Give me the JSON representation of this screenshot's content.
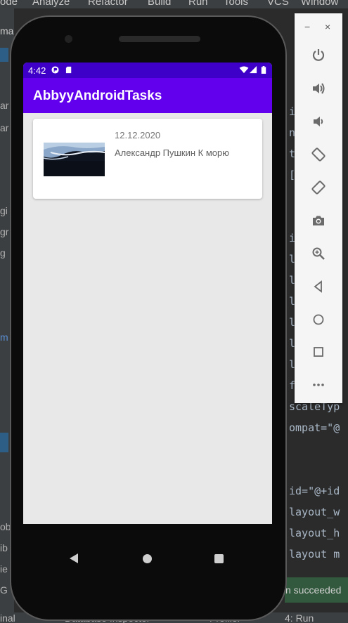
{
  "ide": {
    "menu": [
      "ode",
      "Analyze",
      "Refactor",
      "Build",
      "Run",
      "Tools",
      "VCS",
      "Window"
    ],
    "left_fragments": [
      "mai",
      "ar",
      "ar",
      "gi",
      "gr",
      "g",
      "m",
      "ob",
      "ib",
      "ie",
      "G"
    ],
    "code_lines": [
      "i",
      "n",
      "t",
      "[",
      "i",
      "l",
      "l",
      "l",
      "l",
      "l",
      "l",
      "f",
      "scaleTyp",
      "ompat=\"@",
      "id=\"@+id",
      "layout_w",
      "layout_h",
      "layout m"
    ],
    "bottom_items": [
      "inal",
      "Database Inspector",
      "Profiler",
      "4: Run"
    ],
    "status_text": "n succeeded"
  },
  "phone": {
    "status_bar": {
      "time": "4:42"
    },
    "app_bar": {
      "title": "AbbyyAndroidTasks"
    },
    "cards": [
      {
        "date": "12.12.2020",
        "title": "Александр Пушкин К морю"
      }
    ]
  },
  "emulator_panel": {
    "minimize_label": "−",
    "close_label": "×",
    "buttons": [
      "power-icon",
      "volume-up-icon",
      "volume-down-icon",
      "rotate-left-icon",
      "rotate-right-icon",
      "camera-icon",
      "zoom-icon",
      "back-icon",
      "home-icon",
      "overview-icon",
      "more-icon"
    ]
  },
  "colors": {
    "primary": "#6200ee",
    "primary_dark": "#3e00c9"
  }
}
